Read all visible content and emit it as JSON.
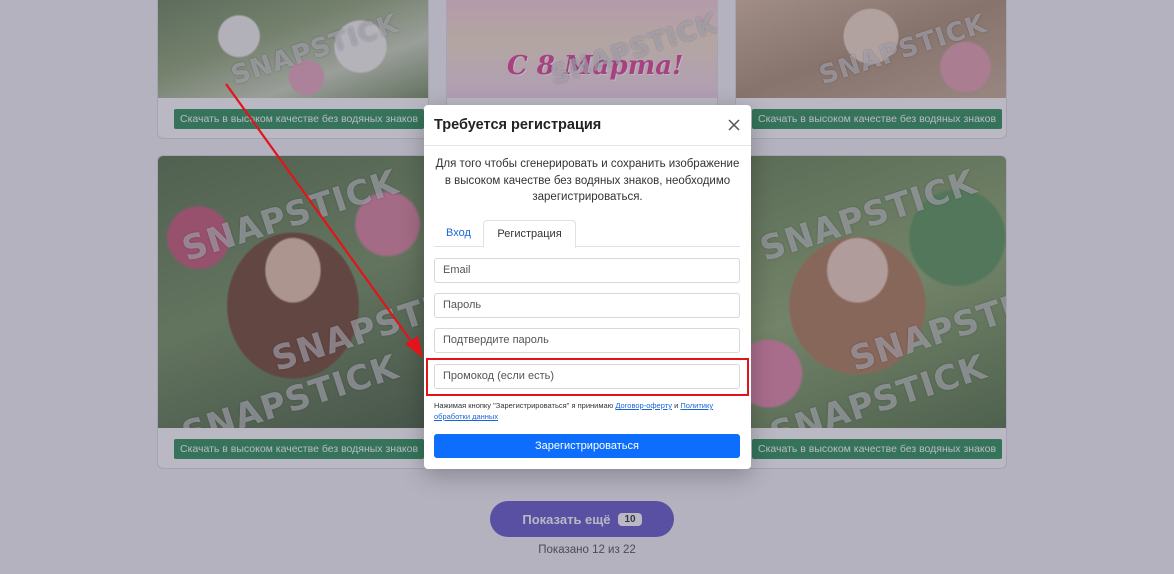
{
  "gallery": {
    "download_label": "Скачать в высоком качестве без водяных знаков",
    "card_march_text": "С 8 Марта!",
    "watermark": "SNAPSTICK",
    "show_more_label": "Показать ещё",
    "show_more_count": "10",
    "shown_text": "Показано 12 из 22"
  },
  "modal": {
    "title": "Требуется регистрация",
    "description": "Для того чтобы сгенерировать и сохранить изображение в высоком качестве без водяных знаков, необходимо зарегистрироваться.",
    "tabs": [
      {
        "label": "Вход",
        "active": false
      },
      {
        "label": "Регистрация",
        "active": true
      }
    ],
    "fields": {
      "email_placeholder": "Email",
      "password_placeholder": "Пароль",
      "confirm_placeholder": "Подтвердите пароль",
      "promo_placeholder": "Промокод (если есть)"
    },
    "terms": {
      "prefix": "Нажимая кнопку \"Зарегистрироваться\" я принимаю",
      "offer_link": "Договор-оферту",
      "and": "и",
      "policy_link": "Политику обработки данных"
    },
    "submit_label": "Зарегистрироваться"
  },
  "colors": {
    "primary": "#0d6efd",
    "highlight": "#e3131c",
    "download_green": "#1c8a4a",
    "show_more": "#5b4ac8"
  },
  "icons": [
    "close-icon"
  ]
}
